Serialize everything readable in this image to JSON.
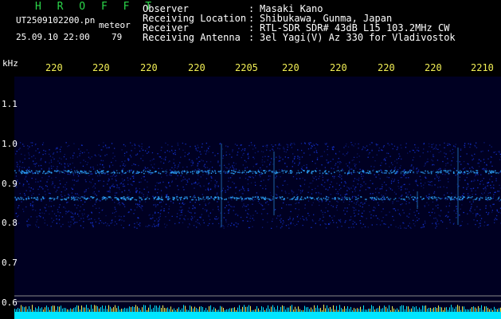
{
  "header": {
    "brand": "H R O F F T",
    "file_name": "UT2509102200.pn",
    "mode": "meteor",
    "timestamp": "25.09.10 22:00",
    "count": "79"
  },
  "station": {
    "rows": [
      {
        "key": "Observer",
        "sep": ":",
        "value": "Masaki Kano"
      },
      {
        "key": "Receiving Location",
        "sep": ":",
        "value": "Shibukawa, Gunma, Japan"
      },
      {
        "key": "Receiver",
        "sep": ":",
        "value": "RTL-SDR SDR# 43dB L15 103.2MHz CW"
      },
      {
        "key": "Receiving Antenna",
        "sep": ":",
        "value": "3el Yagi(V) Az 330 for Vladivostok"
      }
    ]
  },
  "axis": {
    "unit": "kHz",
    "y_ticks": [
      "1.1",
      "1.0",
      "0.9",
      "0.8",
      "0.7",
      "0.6"
    ],
    "time_ticks": [
      "220",
      "220",
      "220",
      "220",
      "2205",
      "220",
      "220",
      "220",
      "220",
      "2210"
    ]
  },
  "colors": {
    "background": "#000022",
    "brand": "#2bd84a",
    "time_labels": "#f2ef55",
    "noise_band": "#1a3fff",
    "echo_line": "#2ea8ff",
    "level_trace": "#00e5ff",
    "level_peaks": "#f2ef55",
    "guide_lines": "#8a8a8a"
  }
}
